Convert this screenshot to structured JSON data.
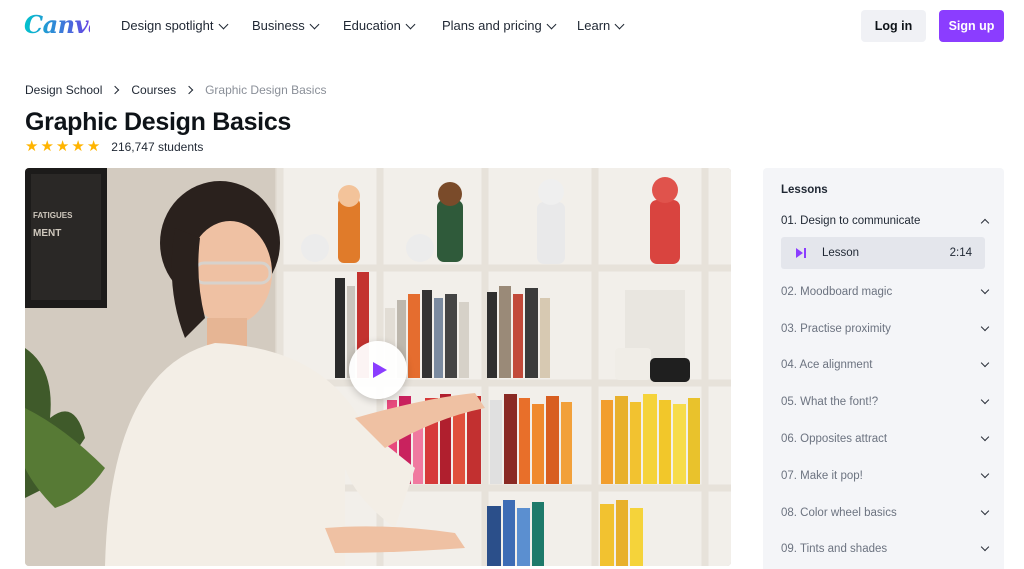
{
  "brand": {
    "name": "Canva",
    "colors": {
      "logo_start": "#00c4cc",
      "logo_end": "#7d2ae8",
      "accent": "#8b3dff",
      "star": "#ffb400"
    }
  },
  "nav": {
    "items": [
      {
        "label": "Design spotlight"
      },
      {
        "label": "Business"
      },
      {
        "label": "Education"
      },
      {
        "label": "Plans and pricing"
      },
      {
        "label": "Learn"
      }
    ],
    "login_label": "Log in",
    "signup_label": "Sign up"
  },
  "breadcrumb": {
    "items": [
      "Design School",
      "Courses",
      "Graphic Design Basics"
    ]
  },
  "course": {
    "title": "Graphic Design Basics",
    "rating_stars": 5,
    "students": "216,747 students"
  },
  "video": {
    "play_icon": "play-icon"
  },
  "lessons": {
    "heading": "Lessons",
    "items": [
      {
        "label": "01.  Design to communicate",
        "expanded": true
      },
      {
        "label": "02.  Moodboard magic"
      },
      {
        "label": "03.  Practise proximity"
      },
      {
        "label": "04.  Ace alignment"
      },
      {
        "label": "05.  What the font!?"
      },
      {
        "label": "06.  Opposites attract"
      },
      {
        "label": "07.  Make it pop!"
      },
      {
        "label": "08.  Color wheel basics"
      },
      {
        "label": "09.  Tints and shades"
      }
    ],
    "active_sublesson": {
      "label": "Lesson",
      "duration": "2:14"
    }
  }
}
